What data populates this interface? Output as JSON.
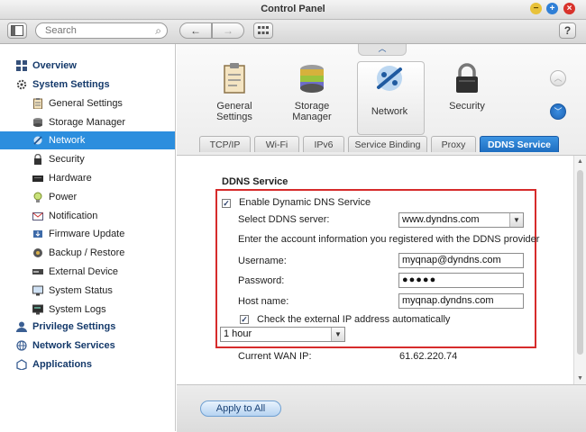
{
  "window": {
    "title": "Control Panel"
  },
  "toolbar": {
    "search_placeholder": "Search",
    "back_glyph": "←",
    "forward_glyph": "→",
    "help_label": "?"
  },
  "sidebar": {
    "items": [
      {
        "label": "Overview",
        "icon": "grid-icon",
        "level": "category"
      },
      {
        "label": "System Settings",
        "icon": "gear-icon",
        "level": "category"
      },
      {
        "label": "General Settings",
        "icon": "clipboard-icon",
        "level": "sub"
      },
      {
        "label": "Storage Manager",
        "icon": "storage-icon",
        "level": "sub"
      },
      {
        "label": "Network",
        "icon": "network-icon",
        "level": "sub",
        "selected": true
      },
      {
        "label": "Security",
        "icon": "lock-icon",
        "level": "sub"
      },
      {
        "label": "Hardware",
        "icon": "hardware-icon",
        "level": "sub"
      },
      {
        "label": "Power",
        "icon": "bulb-icon",
        "level": "sub"
      },
      {
        "label": "Notification",
        "icon": "envelope-icon",
        "level": "sub"
      },
      {
        "label": "Firmware Update",
        "icon": "firmware-icon",
        "level": "sub"
      },
      {
        "label": "Backup / Restore",
        "icon": "backup-icon",
        "level": "sub"
      },
      {
        "label": "External Device",
        "icon": "device-icon",
        "level": "sub"
      },
      {
        "label": "System Status",
        "icon": "monitor-icon",
        "level": "sub"
      },
      {
        "label": "System Logs",
        "icon": "logs-icon",
        "level": "sub"
      },
      {
        "label": "Privilege Settings",
        "icon": "users-icon",
        "level": "category"
      },
      {
        "label": "Network Services",
        "icon": "globe-icon",
        "level": "category"
      },
      {
        "label": "Applications",
        "icon": "apps-icon",
        "level": "category"
      }
    ]
  },
  "categories": [
    {
      "label": "General\nSettings",
      "icon": "clipboard-icon"
    },
    {
      "label": "Storage\nManager",
      "icon": "storage-icon"
    },
    {
      "label": "Network",
      "icon": "network-icon",
      "active": true
    },
    {
      "label": "Security",
      "icon": "lock-icon"
    }
  ],
  "tabs": [
    {
      "label": "TCP/IP"
    },
    {
      "label": "Wi-Fi"
    },
    {
      "label": "IPv6"
    },
    {
      "label": "Service Binding"
    },
    {
      "label": "Proxy"
    },
    {
      "label": "DDNS Service",
      "active": true
    }
  ],
  "ddns": {
    "section_title": "DDNS Service",
    "enable_label": "Enable Dynamic DNS Service",
    "enable_checked": true,
    "server_label": "Select DDNS server:",
    "server_value": "www.dyndns.com",
    "info_text": "Enter the account information you registered with the DDNS provider",
    "username_label": "Username:",
    "username_value": "myqnap@dyndns.com",
    "password_label": "Password:",
    "password_value": "●●●●●",
    "hostname_label": "Host name:",
    "hostname_value": "myqnap.dyndns.com",
    "check_ip_label": "Check the external IP address automatically",
    "check_ip_checked": true,
    "interval_value": "1 hour",
    "wan_label": "Current WAN IP:",
    "wan_value": "61.62.220.74"
  },
  "footer": {
    "apply_label": "Apply to All"
  },
  "colors": {
    "accent": "#2c8ede",
    "highlight_border": "#d62b2b"
  }
}
